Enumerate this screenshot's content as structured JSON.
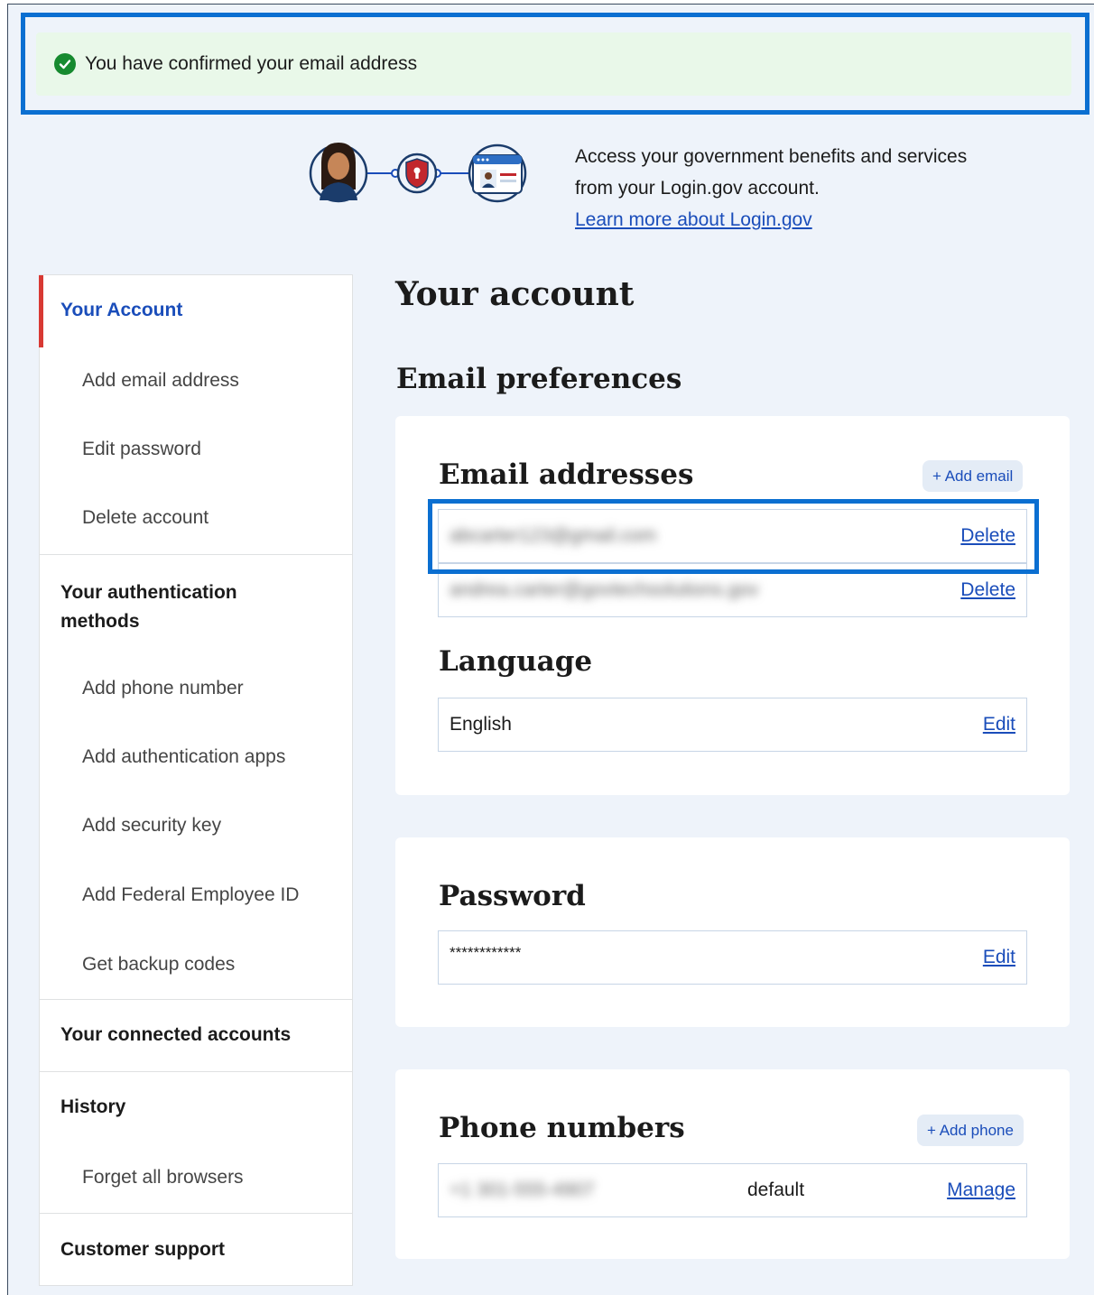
{
  "alert": {
    "message": "You have confirmed your email address",
    "icon": "check-circle-icon",
    "color": "#168a2f"
  },
  "intro": {
    "line1": "Access your government benefits and services",
    "line2": "from your Login.gov account.",
    "link": "Learn more about Login.gov"
  },
  "sidebar": {
    "your_account": "Your Account",
    "add_email": "Add email address",
    "edit_password": "Edit password",
    "delete_account": "Delete account",
    "auth_methods_l1": "Your authentication",
    "auth_methods_l2": "methods",
    "add_phone": "Add phone number",
    "add_auth_apps": "Add authentication apps",
    "add_security_key": "Add security key",
    "add_fed_id": "Add Federal Employee ID",
    "backup_codes": "Get backup codes",
    "connected": "Your connected accounts",
    "history": "History",
    "forget_browsers": "Forget all browsers",
    "support": "Customer support"
  },
  "main": {
    "title": "Your account",
    "email_prefs": "Email preferences",
    "email_addresses": "Email addresses",
    "add_email": "+ Add email",
    "emails": [
      {
        "value": "abcarter123@gmail.com",
        "action": "Delete"
      },
      {
        "value": "andrea.carter@govtechsolutions.gov",
        "action": "Delete"
      }
    ],
    "language_heading": "Language",
    "language_value": "English",
    "language_action": "Edit",
    "password_heading": "Password",
    "password_value": "************",
    "password_action": "Edit",
    "phone_heading": "Phone numbers",
    "add_phone": "+ Add phone",
    "phone_value": "+1 301-555-4907",
    "phone_default": "default",
    "phone_action": "Manage"
  }
}
